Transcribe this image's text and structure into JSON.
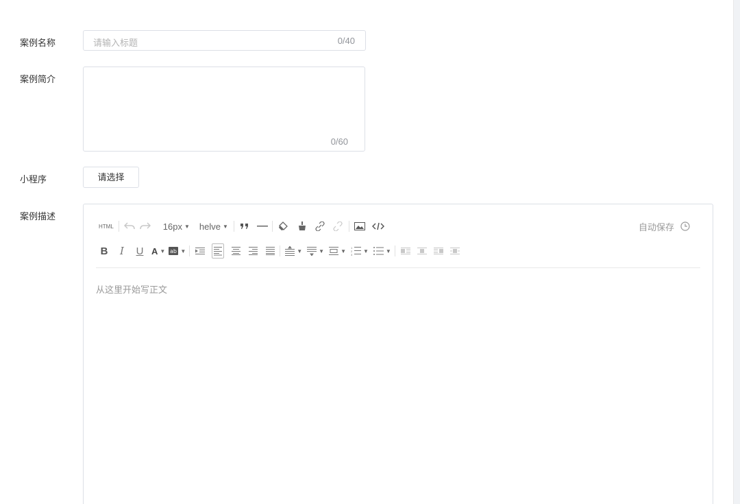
{
  "form": {
    "name_label": "案例名称",
    "name_placeholder": "请输入标题",
    "name_count": "0/40",
    "intro_label": "案例简介",
    "intro_count": "0/60",
    "mini_label": "小程序",
    "mini_button": "请选择",
    "desc_label": "案例描述"
  },
  "editor": {
    "html_label": "HTML",
    "font_size": "16px",
    "font_family": "helve",
    "autosave_label": "自动保存",
    "body_placeholder": "从这里开始写正文",
    "toolbar_icons_row1": [
      "html-icon",
      "undo-icon",
      "redo-icon",
      "font-size-select",
      "font-family-select",
      "quote-icon",
      "horizontal-rule-icon",
      "eraser-icon",
      "format-brush-icon",
      "link-icon",
      "unlink-icon",
      "image-icon",
      "code-icon"
    ],
    "toolbar_icons_row2": [
      "bold-icon",
      "italic-icon",
      "underline-icon",
      "font-color-icon",
      "background-color-icon",
      "indent-icon",
      "align-left-icon",
      "align-center-icon",
      "align-right-icon",
      "align-justify-icon",
      "line-height-icon",
      "paragraph-spacing-icon",
      "indent-spacing-icon",
      "ordered-list-icon",
      "unordered-list-icon",
      "float-left-icon",
      "float-none-icon",
      "float-right-icon",
      "float-center-icon"
    ]
  }
}
